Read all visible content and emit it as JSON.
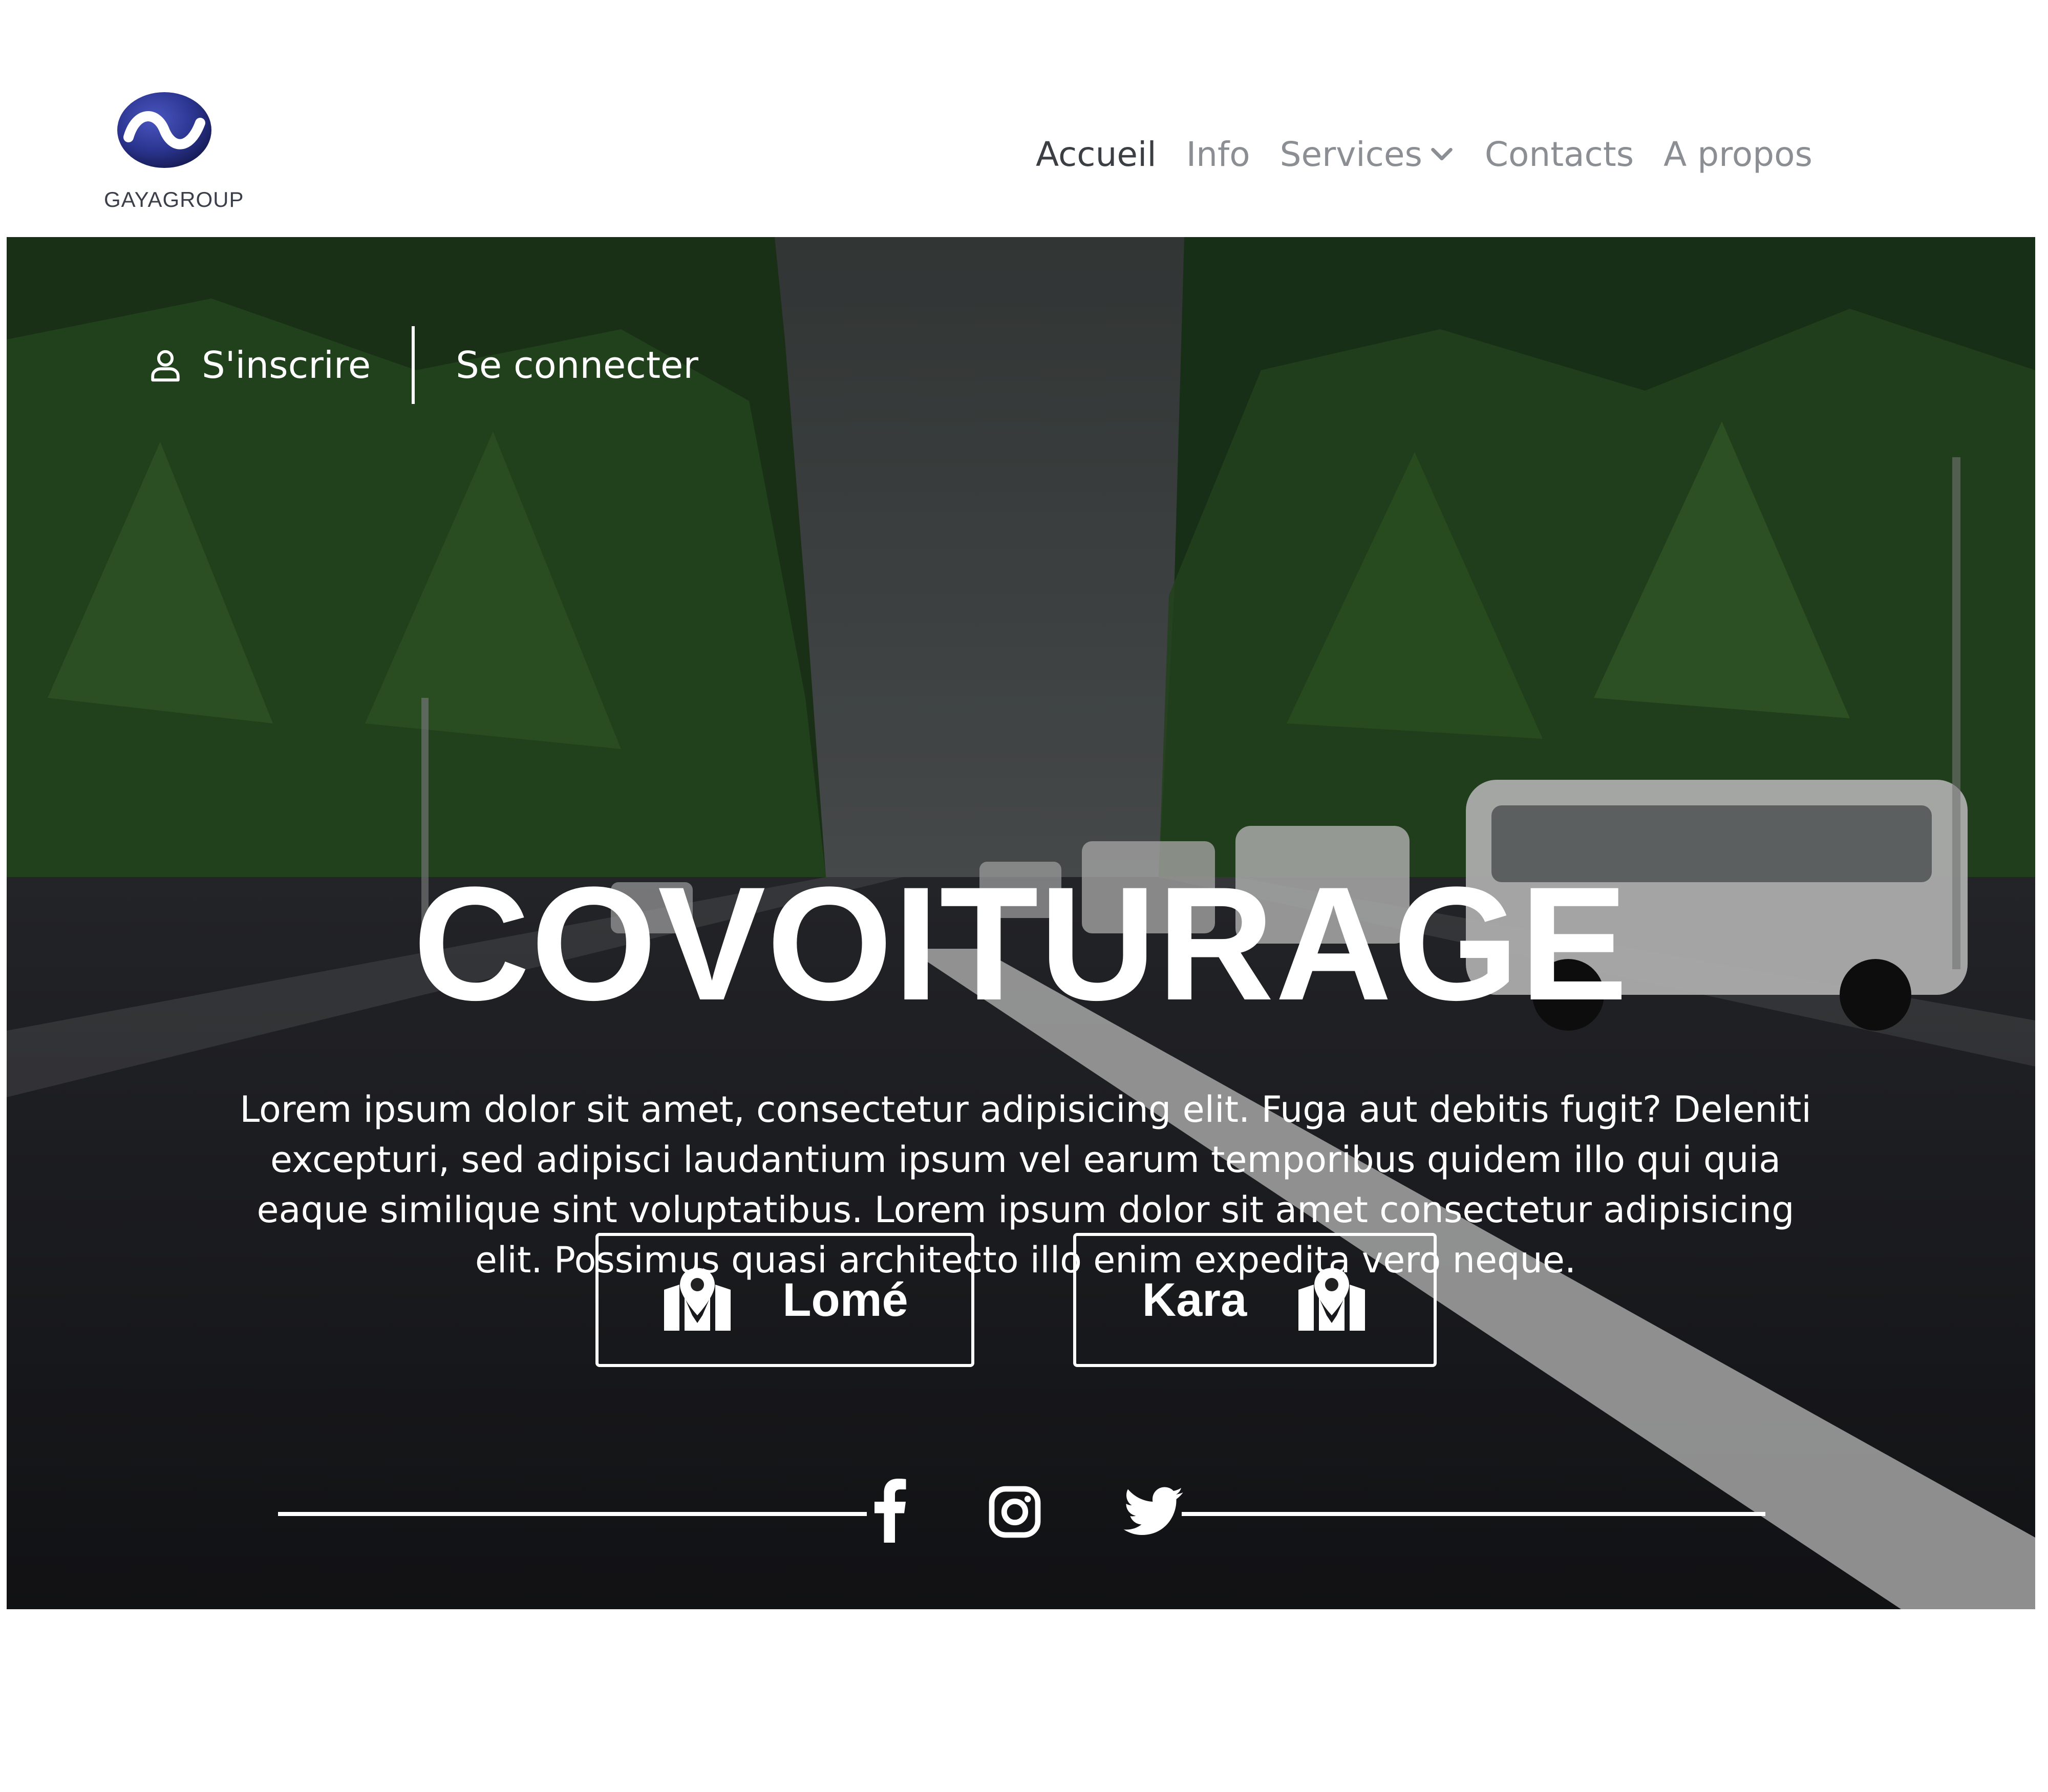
{
  "header": {
    "brand": "GAYAGROUP",
    "nav": [
      {
        "label": "Accueil",
        "active": true
      },
      {
        "label": "Info"
      },
      {
        "label": "Services",
        "icon": "chevron-down-icon"
      },
      {
        "label": "Contacts"
      },
      {
        "label": "A propos"
      }
    ]
  },
  "hero": {
    "auth": {
      "register_label": "S'inscrire",
      "register_icon": "user-icon",
      "login_label": "Se connecter"
    },
    "title": "COVOITURAGE",
    "description": "Lorem ipsum dolor sit amet, consectetur adipisicing elit. Fuga aut debitis fugit? Deleniti excepturi, sed adipisci laudantium ipsum vel earum temporibus quidem illo qui quia eaque similique sint voluptatibus. Lorem ipsum dolor sit amet consectetur adipisicing elit. Possimus quasi architecto illo enim expedita vero neque.",
    "cities": [
      {
        "label": "Lomé",
        "icon": "map-marker-icon"
      },
      {
        "label": "Kara",
        "icon": "map-marker-icon"
      }
    ],
    "social": [
      "facebook-icon",
      "instagram-icon",
      "twitter-icon"
    ]
  },
  "colors": {
    "nav_active": "#3b3e43",
    "nav_inactive": "#8b8e93",
    "logo_blue": "#2b3590",
    "hero_text": "#ffffff"
  }
}
